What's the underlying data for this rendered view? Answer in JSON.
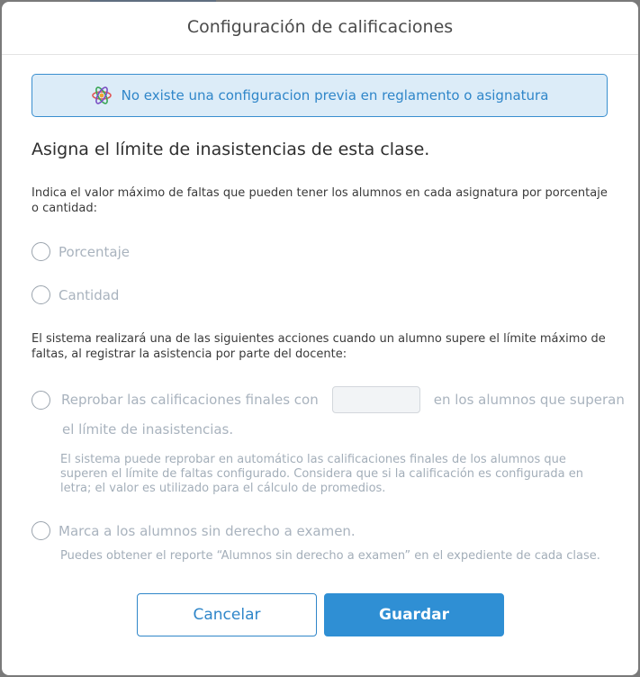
{
  "modal": {
    "title": "Configuración de calificaciones"
  },
  "notice": {
    "icon": "atom-icon",
    "text": "No existe una configuracion previa en reglamento o asignatura"
  },
  "section": {
    "title": "Asigna el límite de inasistencias de esta clase.",
    "limit_help": "Indica el valor máximo de faltas que pueden tener los alumnos en cada asignatura por porcentaje o cantidad:",
    "limit_options": [
      {
        "label": "Porcentaje"
      },
      {
        "label": "Cantidad"
      }
    ],
    "actions_help": "El sistema realizará una de las siguientes acciones cuando un alumno supere el límite máximo de faltas, al registrar la asistencia por parte del docente:",
    "action_fail": {
      "label_before": "Reprobar las calificaciones finales con",
      "input_value": "",
      "label_after": "en los alumnos que superan",
      "label_line2": "el límite de inasistencias.",
      "description": "El sistema puede reprobar en automático las calificaciones finales de los alumnos que superen el límite de faltas configurado. Considera que si la calificación es configurada en letra; el valor es utilizado para el cálculo de promedios."
    },
    "action_exam": {
      "label": "Marca a los alumnos sin derecho a examen.",
      "description": "Puedes obtener el reporte “Alumnos sin derecho a examen” en el expediente de cada clase."
    }
  },
  "buttons": {
    "cancel": "Cancelar",
    "save": "Guardar"
  },
  "colors": {
    "accent": "#2f8fd4",
    "notice_bg": "#dcecf8",
    "notice_border": "#3a8fcf",
    "muted_text": "#a9b3be"
  }
}
